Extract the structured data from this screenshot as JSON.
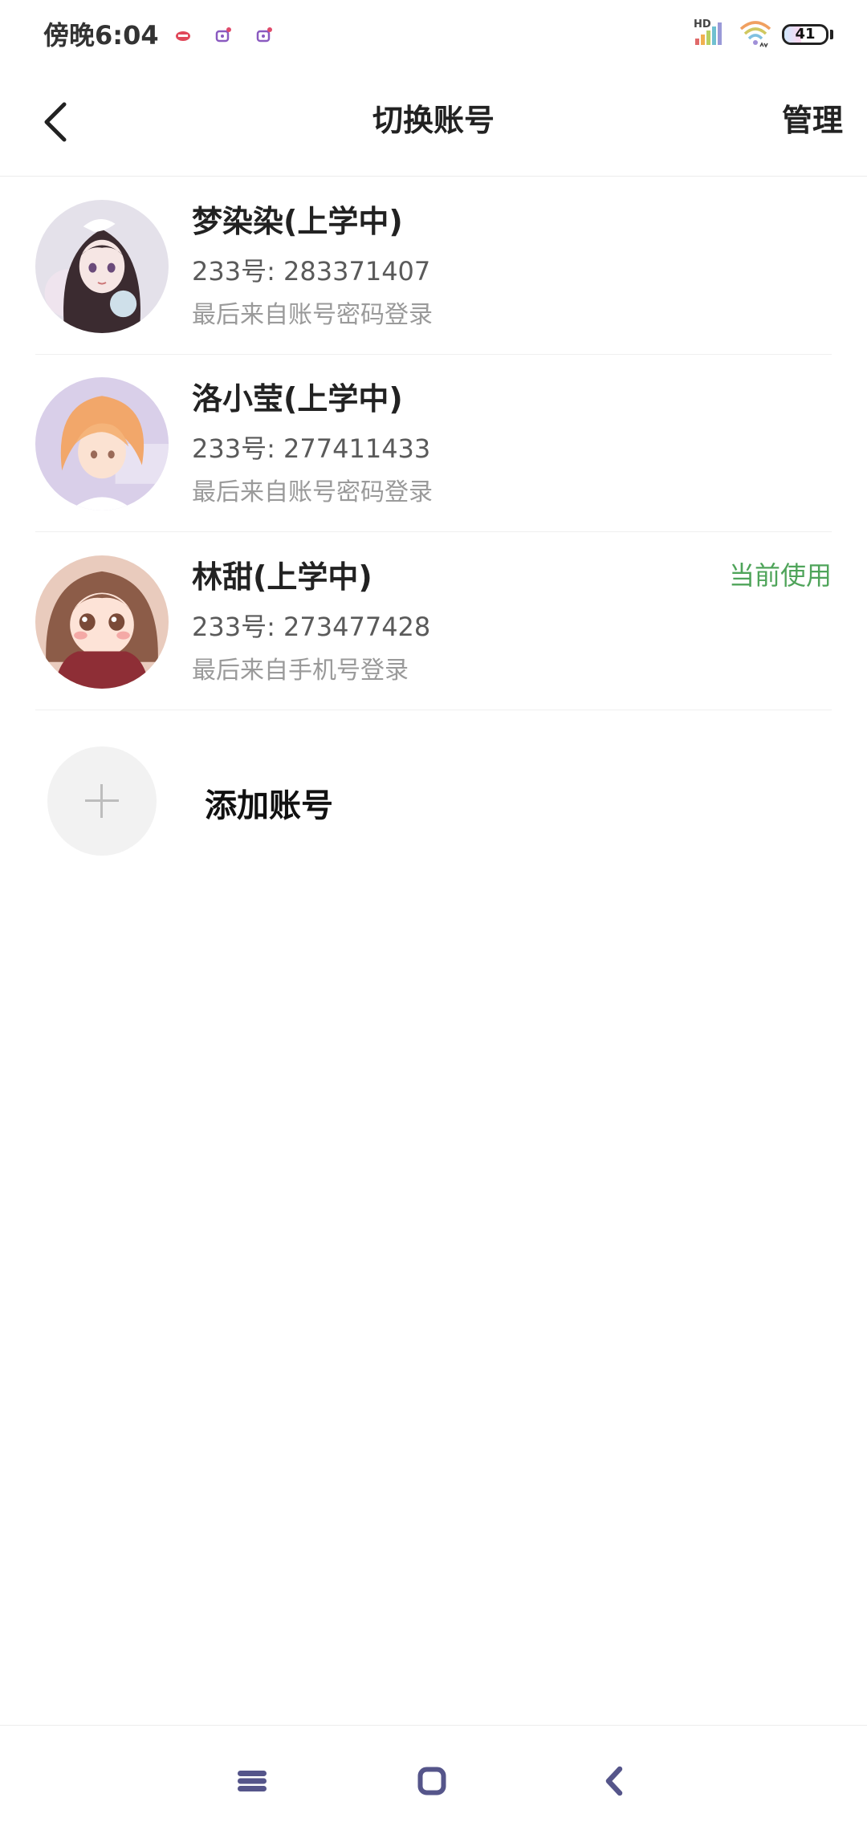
{
  "status_bar": {
    "time": "傍晚6:04",
    "network_label": "HD",
    "battery": "41",
    "battery_level": 0.41
  },
  "header": {
    "title": "切换账号",
    "manage_label": "管理"
  },
  "accounts": [
    {
      "name": "梦染染(上学中)",
      "id_line": "233号: 283371407",
      "login_source": "最后来自账号密码登录"
    },
    {
      "name": "洛小莹(上学中)",
      "id_line": "233号: 277411433",
      "login_source": "最后来自账号密码登录"
    },
    {
      "name": "林甜(上学中)",
      "id_line": "233号: 273477428",
      "login_source": "最后来自手机号登录",
      "current_label": "当前使用"
    }
  ],
  "add_account": {
    "label": "添加账号"
  },
  "icons": {
    "back": "chevron-left-icon",
    "add": "plus-icon",
    "nav_menu": "menu-icon",
    "nav_home": "home-square-icon",
    "nav_back": "nav-back-icon"
  },
  "colors": {
    "current_accent": "#4fa45a",
    "nav_icon": "#55558a",
    "divider": "#ececec"
  }
}
